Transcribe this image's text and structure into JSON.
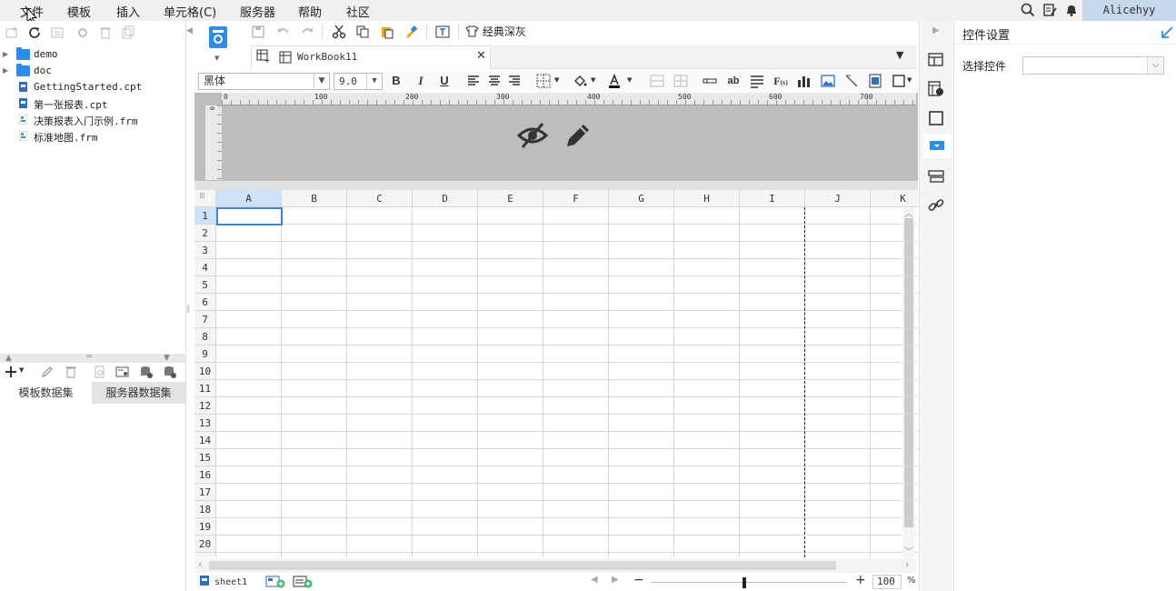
{
  "menubar": {
    "items": [
      "文件",
      "模板",
      "插入",
      "单元格(C)",
      "服务器",
      "帮助",
      "社区"
    ],
    "user": "Alicehyy"
  },
  "file_tree": [
    {
      "label": "demo",
      "type": "folder"
    },
    {
      "label": "doc",
      "type": "folder"
    },
    {
      "label": "GettingStarted.cpt",
      "type": "cpt"
    },
    {
      "label": "第一张报表.cpt",
      "type": "cpt"
    },
    {
      "label": "决策报表入门示例.frm",
      "type": "frm"
    },
    {
      "label": "标准地图.frm",
      "type": "frm"
    }
  ],
  "dataset_tabs": [
    "模板数据集",
    "服务器数据集"
  ],
  "toolbar": {
    "theme_label": "经典深灰"
  },
  "workbook_tab": "WorkBook11",
  "format_bar": {
    "font_name": "黑体",
    "font_size": "9.0",
    "bold": "B",
    "italic": "I",
    "underline": "U"
  },
  "ruler_labels": [
    "0",
    "100",
    "200",
    "300",
    "400",
    "500",
    "600",
    "700"
  ],
  "grid": {
    "columns": [
      "A",
      "B",
      "C",
      "D",
      "E",
      "F",
      "G",
      "H",
      "I",
      "J",
      "K"
    ],
    "rows": [
      "1",
      "2",
      "3",
      "4",
      "5",
      "6",
      "7",
      "8",
      "9",
      "10",
      "11",
      "12",
      "13",
      "14",
      "15",
      "16",
      "17",
      "18",
      "19",
      "20"
    ],
    "selected_cell": "A1"
  },
  "bottom": {
    "sheet_name": "sheet1",
    "zoom_value": "100",
    "zoom_unit": "%",
    "zoom_minus": "−",
    "zoom_plus": "+"
  },
  "right_panel": {
    "title": "控件设置",
    "select_label": "选择控件",
    "select_value": ""
  },
  "colors": {
    "accent_blue": "#2e8be6",
    "user_box": "#c7d8ec",
    "param_area": "#bdbdbd",
    "selection": "#3a87d6"
  }
}
